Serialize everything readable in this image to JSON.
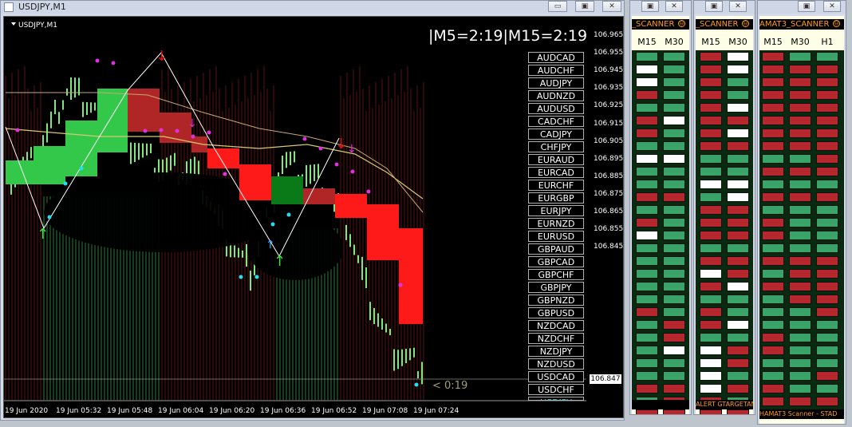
{
  "main_window": {
    "title": "USDJPY,M1",
    "btn_min": "▭",
    "btn_max": "▣",
    "btn_close": "✕",
    "symbol_label": "USDJPY,M1",
    "countdown_text": "|M5=2:19|M15=2:19",
    "current_price": "106.847",
    "bar_countdown": "< 0:19",
    "pairs": [
      "AUDCAD",
      "AUDCHF",
      "AUDJPY",
      "AUDNZD",
      "AUDUSD",
      "CADCHF",
      "CADJPY",
      "CHFJPY",
      "EURAUD",
      "EURCAD",
      "EURCHF",
      "EURGBP",
      "EURJPY",
      "EURNZD",
      "EURUSD",
      "GBPAUD",
      "GBPCAD",
      "GBPCHF",
      "GBPJPY",
      "GBPNZD",
      "GBPUSD",
      "NZDCAD",
      "NZDCHF",
      "NZDJPY",
      "NZDUSD",
      "USDCAD",
      "USDCHF",
      "USDJPY"
    ],
    "y_ticks": [
      "106.965",
      "106.955",
      "106.945",
      "106.935",
      "106.925",
      "106.915",
      "106.905",
      "106.895",
      "106.885",
      "106.875",
      "106.865",
      "106.855",
      "106.845"
    ],
    "x_ticks": [
      "19 Jun 2020",
      "19 Jun 05:32",
      "19 Jun 05:48",
      "19 Jun 06:04",
      "19 Jun 06:20",
      "19 Jun 06:36",
      "19 Jun 06:52",
      "19 Jun 07:08",
      "19 Jun 07:24"
    ]
  },
  "scanners": [
    {
      "title": "_SCANNER",
      "columns": [
        "M15",
        "M30"
      ],
      "rows": [
        "gg",
        "wg",
        "wg",
        "rg",
        "gg",
        "rw",
        "rg",
        "gg",
        "ww",
        "gg",
        "gg",
        "rr",
        "gg",
        "rg",
        "wg",
        "gg",
        "gg",
        "gg",
        "gg",
        "gg",
        "rg",
        "gr",
        "gr",
        "gw",
        "gg",
        "gg",
        "rr",
        "gr",
        "rr"
      ],
      "footer": ""
    },
    {
      "title": "_SCANNER",
      "columns": [
        "M15",
        "M30"
      ],
      "rows": [
        "rw",
        "rw",
        "rg",
        "rg",
        "rw",
        "rr",
        "rw",
        "rr",
        "gg",
        "gg",
        "ww",
        "gw",
        "rr",
        "rr",
        "rr",
        "gg",
        "rr",
        "wr",
        "rw",
        "gg",
        "rg",
        "rw",
        "gg",
        "wr",
        "wr",
        "wg",
        "wr",
        "rg",
        "rr"
      ],
      "footer": "ALERT GTARGETANAT"
    },
    {
      "title": "AMAT3_SCANNER",
      "columns": [
        "M15",
        "M30",
        "H1"
      ],
      "rows": [
        "rgg",
        "rrr",
        "rrr",
        "rrr",
        "rrr",
        "rrr",
        "rrr",
        "rrr",
        "ggr",
        "rrr",
        "ggg",
        "rrr",
        "ggg",
        "rgg",
        "rgg",
        "ggg",
        "rrr",
        "grr",
        "rrr",
        "grr",
        "ggr",
        "ggg",
        "rgg",
        "rgg",
        "ggg",
        "ggr",
        "rgg",
        "rrr",
        "rgg"
      ],
      "footer": "HAMAT3 Scanner - STAD"
    }
  ]
}
